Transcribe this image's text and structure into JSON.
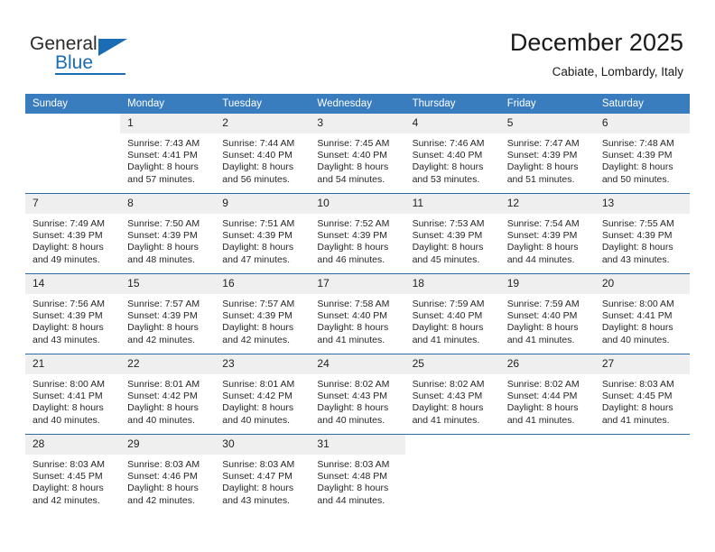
{
  "brand": {
    "line1": "General",
    "line2": "Blue",
    "accent_color": "#1a6cb5"
  },
  "header": {
    "month_title": "December 2025",
    "location": "Cabiate, Lombardy, Italy"
  },
  "calendar": {
    "header_bg": "#3a7dbf",
    "daynum_bg": "#efefef",
    "weekday_names": [
      "Sunday",
      "Monday",
      "Tuesday",
      "Wednesday",
      "Thursday",
      "Friday",
      "Saturday"
    ],
    "weeks": [
      [
        {
          "day": "",
          "lines": []
        },
        {
          "day": "1",
          "lines": [
            "Sunrise: 7:43 AM",
            "Sunset: 4:41 PM",
            "Daylight: 8 hours",
            "and 57 minutes."
          ]
        },
        {
          "day": "2",
          "lines": [
            "Sunrise: 7:44 AM",
            "Sunset: 4:40 PM",
            "Daylight: 8 hours",
            "and 56 minutes."
          ]
        },
        {
          "day": "3",
          "lines": [
            "Sunrise: 7:45 AM",
            "Sunset: 4:40 PM",
            "Daylight: 8 hours",
            "and 54 minutes."
          ]
        },
        {
          "day": "4",
          "lines": [
            "Sunrise: 7:46 AM",
            "Sunset: 4:40 PM",
            "Daylight: 8 hours",
            "and 53 minutes."
          ]
        },
        {
          "day": "5",
          "lines": [
            "Sunrise: 7:47 AM",
            "Sunset: 4:39 PM",
            "Daylight: 8 hours",
            "and 51 minutes."
          ]
        },
        {
          "day": "6",
          "lines": [
            "Sunrise: 7:48 AM",
            "Sunset: 4:39 PM",
            "Daylight: 8 hours",
            "and 50 minutes."
          ]
        }
      ],
      [
        {
          "day": "7",
          "lines": [
            "Sunrise: 7:49 AM",
            "Sunset: 4:39 PM",
            "Daylight: 8 hours",
            "and 49 minutes."
          ]
        },
        {
          "day": "8",
          "lines": [
            "Sunrise: 7:50 AM",
            "Sunset: 4:39 PM",
            "Daylight: 8 hours",
            "and 48 minutes."
          ]
        },
        {
          "day": "9",
          "lines": [
            "Sunrise: 7:51 AM",
            "Sunset: 4:39 PM",
            "Daylight: 8 hours",
            "and 47 minutes."
          ]
        },
        {
          "day": "10",
          "lines": [
            "Sunrise: 7:52 AM",
            "Sunset: 4:39 PM",
            "Daylight: 8 hours",
            "and 46 minutes."
          ]
        },
        {
          "day": "11",
          "lines": [
            "Sunrise: 7:53 AM",
            "Sunset: 4:39 PM",
            "Daylight: 8 hours",
            "and 45 minutes."
          ]
        },
        {
          "day": "12",
          "lines": [
            "Sunrise: 7:54 AM",
            "Sunset: 4:39 PM",
            "Daylight: 8 hours",
            "and 44 minutes."
          ]
        },
        {
          "day": "13",
          "lines": [
            "Sunrise: 7:55 AM",
            "Sunset: 4:39 PM",
            "Daylight: 8 hours",
            "and 43 minutes."
          ]
        }
      ],
      [
        {
          "day": "14",
          "lines": [
            "Sunrise: 7:56 AM",
            "Sunset: 4:39 PM",
            "Daylight: 8 hours",
            "and 43 minutes."
          ]
        },
        {
          "day": "15",
          "lines": [
            "Sunrise: 7:57 AM",
            "Sunset: 4:39 PM",
            "Daylight: 8 hours",
            "and 42 minutes."
          ]
        },
        {
          "day": "16",
          "lines": [
            "Sunrise: 7:57 AM",
            "Sunset: 4:39 PM",
            "Daylight: 8 hours",
            "and 42 minutes."
          ]
        },
        {
          "day": "17",
          "lines": [
            "Sunrise: 7:58 AM",
            "Sunset: 4:40 PM",
            "Daylight: 8 hours",
            "and 41 minutes."
          ]
        },
        {
          "day": "18",
          "lines": [
            "Sunrise: 7:59 AM",
            "Sunset: 4:40 PM",
            "Daylight: 8 hours",
            "and 41 minutes."
          ]
        },
        {
          "day": "19",
          "lines": [
            "Sunrise: 7:59 AM",
            "Sunset: 4:40 PM",
            "Daylight: 8 hours",
            "and 41 minutes."
          ]
        },
        {
          "day": "20",
          "lines": [
            "Sunrise: 8:00 AM",
            "Sunset: 4:41 PM",
            "Daylight: 8 hours",
            "and 40 minutes."
          ]
        }
      ],
      [
        {
          "day": "21",
          "lines": [
            "Sunrise: 8:00 AM",
            "Sunset: 4:41 PM",
            "Daylight: 8 hours",
            "and 40 minutes."
          ]
        },
        {
          "day": "22",
          "lines": [
            "Sunrise: 8:01 AM",
            "Sunset: 4:42 PM",
            "Daylight: 8 hours",
            "and 40 minutes."
          ]
        },
        {
          "day": "23",
          "lines": [
            "Sunrise: 8:01 AM",
            "Sunset: 4:42 PM",
            "Daylight: 8 hours",
            "and 40 minutes."
          ]
        },
        {
          "day": "24",
          "lines": [
            "Sunrise: 8:02 AM",
            "Sunset: 4:43 PM",
            "Daylight: 8 hours",
            "and 40 minutes."
          ]
        },
        {
          "day": "25",
          "lines": [
            "Sunrise: 8:02 AM",
            "Sunset: 4:43 PM",
            "Daylight: 8 hours",
            "and 41 minutes."
          ]
        },
        {
          "day": "26",
          "lines": [
            "Sunrise: 8:02 AM",
            "Sunset: 4:44 PM",
            "Daylight: 8 hours",
            "and 41 minutes."
          ]
        },
        {
          "day": "27",
          "lines": [
            "Sunrise: 8:03 AM",
            "Sunset: 4:45 PM",
            "Daylight: 8 hours",
            "and 41 minutes."
          ]
        }
      ],
      [
        {
          "day": "28",
          "lines": [
            "Sunrise: 8:03 AM",
            "Sunset: 4:45 PM",
            "Daylight: 8 hours",
            "and 42 minutes."
          ]
        },
        {
          "day": "29",
          "lines": [
            "Sunrise: 8:03 AM",
            "Sunset: 4:46 PM",
            "Daylight: 8 hours",
            "and 42 minutes."
          ]
        },
        {
          "day": "30",
          "lines": [
            "Sunrise: 8:03 AM",
            "Sunset: 4:47 PM",
            "Daylight: 8 hours",
            "and 43 minutes."
          ]
        },
        {
          "day": "31",
          "lines": [
            "Sunrise: 8:03 AM",
            "Sunset: 4:48 PM",
            "Daylight: 8 hours",
            "and 44 minutes."
          ]
        },
        {
          "day": "",
          "lines": []
        },
        {
          "day": "",
          "lines": []
        },
        {
          "day": "",
          "lines": []
        }
      ]
    ]
  }
}
